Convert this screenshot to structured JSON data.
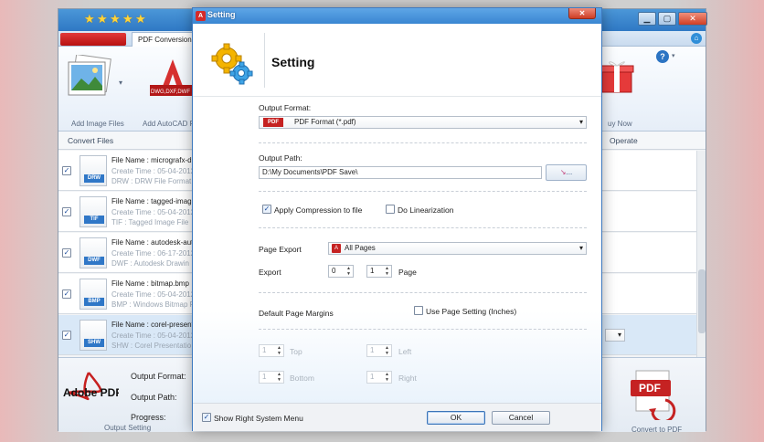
{
  "app": {
    "tab_pdf_conversion": "PDF Conversion",
    "ribbon": {
      "add_image_files": "Add Image Files",
      "add_autocad": "Add AutoCAD F",
      "buy_now": "uy Now",
      "autocad_badge": "DWG,DXF,DWF"
    },
    "list": {
      "convert_files_header": "Convert Files",
      "operate_header": "Operate",
      "rows": [
        {
          "name": "File Name : micrografx-de",
          "time": "Create Time : 05-04-2012",
          "type": "DRW : DRW File Format",
          "tag": "DRW",
          "checked": true,
          "selected": false
        },
        {
          "name": "File Name : tagged-image",
          "time": "Create Time : 05-04-2012",
          "type": "TIF : Tagged Image File",
          "tag": "TIF",
          "checked": true,
          "selected": false
        },
        {
          "name": "File Name : autodesk-auto",
          "time": "Create Time : 06-17-2012",
          "type": "DWF : Autodesk Drawin",
          "tag": "DWF",
          "checked": true,
          "selected": false
        },
        {
          "name": "File Name : bitmap.bmp",
          "time": "Create Time : 05-04-2012",
          "type": "BMP : Windows Bitmap F",
          "tag": "BMP",
          "checked": true,
          "selected": false
        },
        {
          "name": "File Name : corel-present",
          "time": "Create Time : 05-04-2012",
          "type": "SHW : Corel Presentatio",
          "tag": "SHW",
          "checked": true,
          "selected": true
        }
      ]
    },
    "bottom": {
      "output_format_label": "Output Format:",
      "output_path_label": "Output Path:",
      "progress_label": "Progress:",
      "output_setting": "Output Setting",
      "convert_to_pdf": "Convert to PDF",
      "adobe_pdf_text": "Adobe PDF",
      "pdf_word": "PDF"
    }
  },
  "dialog": {
    "title": "Setting",
    "heading": "Setting",
    "output_format_label": "Output Format:",
    "output_format_value": "PDF Format (*.pdf)",
    "output_path_label": "Output Path:",
    "output_path_value": "D:\\My Documents\\PDF Save\\",
    "browse_label": "...",
    "apply_compression_label": "Apply Compression to file",
    "do_linearization_label": "Do Linearization",
    "page_export_label": "Page Export",
    "page_export_value": "All Pages",
    "export_label": "Export",
    "export_from": "0",
    "export_to": "1",
    "page_label": "Page",
    "default_margins_label": "Default Page Margins",
    "use_page_setting_label": "Use Page Setting (Inches)",
    "margin_top_value": "1",
    "margin_top_label": "Top",
    "margin_left_value": "1",
    "margin_left_label": "Left",
    "margin_bottom_value": "1",
    "margin_bottom_label": "Bottom",
    "margin_right_value": "1",
    "margin_right_label": "Right",
    "show_right_menu_label": "Show Right System Menu",
    "ok_label": "OK",
    "cancel_label": "Cancel",
    "pdf_badge": "PDF"
  },
  "colors": {
    "titlebar_blue": "#3a86d2",
    "pdf_red": "#c52222",
    "selection": "#d9e8f7"
  },
  "icons": [
    "star-icon",
    "gear-icon",
    "gift-icon",
    "help-icon",
    "home-icon",
    "close-icon",
    "pdf-icon",
    "checkmark-icon",
    "chevron-down-icon"
  ]
}
